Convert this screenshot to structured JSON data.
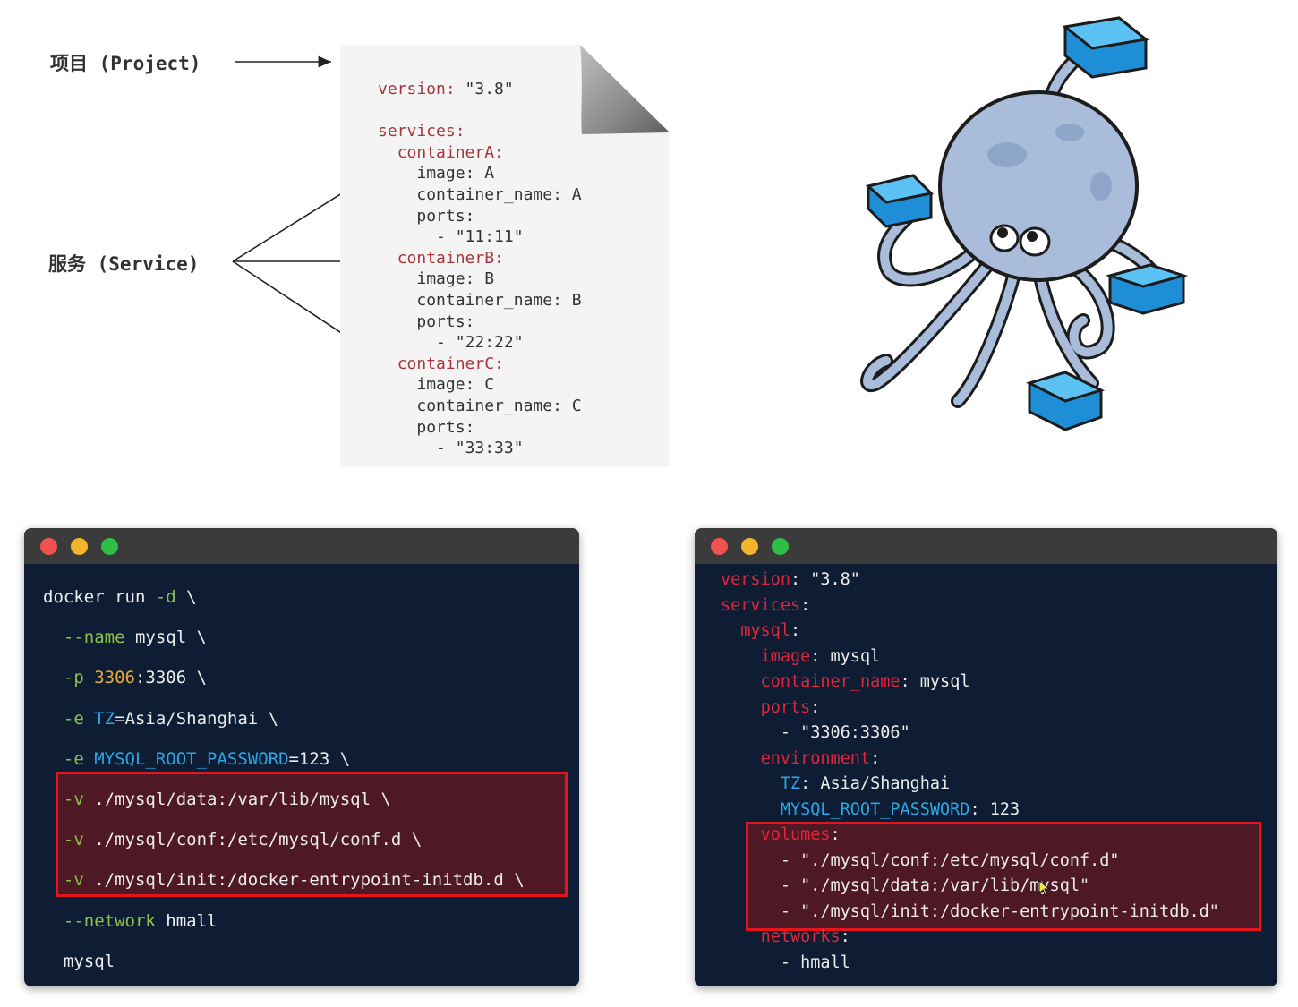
{
  "labels": {
    "project": "项目 (Project)",
    "service": "服务 (Service)"
  },
  "compose_doc": {
    "lines": [
      {
        "indent": "",
        "key": "version",
        "value": " \"3.8\""
      },
      {
        "indent": "",
        "key": "",
        "value": ""
      },
      {
        "indent": "",
        "key": "services",
        "value": ""
      },
      {
        "indent": "  ",
        "key": "containerA",
        "value": ""
      },
      {
        "indent": "    ",
        "key": "",
        "value": "image: A"
      },
      {
        "indent": "    ",
        "key": "",
        "value": "container_name: A"
      },
      {
        "indent": "    ",
        "key": "",
        "value": "ports:"
      },
      {
        "indent": "      ",
        "key": "",
        "value": "- \"11:11\""
      },
      {
        "indent": "  ",
        "key": "containerB",
        "value": ""
      },
      {
        "indent": "    ",
        "key": "",
        "value": "image: B"
      },
      {
        "indent": "    ",
        "key": "",
        "value": "container_name: B"
      },
      {
        "indent": "    ",
        "key": "",
        "value": "ports:"
      },
      {
        "indent": "      ",
        "key": "",
        "value": "- \"22:22\""
      },
      {
        "indent": "  ",
        "key": "containerC",
        "value": ""
      },
      {
        "indent": "    ",
        "key": "",
        "value": "image: C"
      },
      {
        "indent": "    ",
        "key": "",
        "value": "container_name: C"
      },
      {
        "indent": "    ",
        "key": "",
        "value": "ports:"
      },
      {
        "indent": "      ",
        "key": "",
        "value": "- \"33:33\""
      }
    ]
  },
  "docker_run": {
    "lines": [
      [
        {
          "t": "docker run ",
          "c": ""
        },
        {
          "t": "-d",
          "c": "green"
        },
        {
          "t": " \\",
          "c": ""
        }
      ],
      [
        {
          "t": "  --name",
          "c": "green"
        },
        {
          "t": " mysql \\",
          "c": ""
        }
      ],
      [
        {
          "t": "  -p ",
          "c": "green"
        },
        {
          "t": "3306",
          "c": "orange"
        },
        {
          "t": ":3306 \\",
          "c": ""
        }
      ],
      [
        {
          "t": "  -e ",
          "c": "green"
        },
        {
          "t": "TZ",
          "c": "blue"
        },
        {
          "t": "=Asia/Shanghai \\",
          "c": ""
        }
      ],
      [
        {
          "t": "  -e ",
          "c": "green"
        },
        {
          "t": "MYSQL_ROOT_PASSWORD",
          "c": "blue"
        },
        {
          "t": "=123 \\",
          "c": ""
        }
      ],
      [
        {
          "t": "  -v",
          "c": "green"
        },
        {
          "t": " ./mysql/data:/var/lib/mysql \\",
          "c": ""
        }
      ],
      [
        {
          "t": "  -v",
          "c": "green"
        },
        {
          "t": " ./mysql/conf:/etc/mysql/conf.d \\",
          "c": ""
        }
      ],
      [
        {
          "t": "  -v",
          "c": "green"
        },
        {
          "t": " ./mysql/init:/docker-entrypoint-initdb.d \\",
          "c": ""
        }
      ],
      [
        {
          "t": "  --network",
          "c": "green"
        },
        {
          "t": " hmall",
          "c": ""
        }
      ],
      [
        {
          "t": "  mysql",
          "c": ""
        }
      ]
    ]
  },
  "compose_yaml": {
    "lines": [
      [
        {
          "t": "version",
          "c": "red"
        },
        {
          "t": ": \"3.8\"",
          "c": ""
        }
      ],
      [
        {
          "t": "services",
          "c": "red"
        },
        {
          "t": ":",
          "c": ""
        }
      ],
      [
        {
          "t": "  ",
          "c": ""
        },
        {
          "t": "mysql",
          "c": "red"
        },
        {
          "t": ":",
          "c": ""
        }
      ],
      [
        {
          "t": "    ",
          "c": ""
        },
        {
          "t": "image",
          "c": "red"
        },
        {
          "t": ": mysql",
          "c": ""
        }
      ],
      [
        {
          "t": "    ",
          "c": ""
        },
        {
          "t": "container_name",
          "c": "red"
        },
        {
          "t": ": mysql",
          "c": ""
        }
      ],
      [
        {
          "t": "    ",
          "c": ""
        },
        {
          "t": "ports",
          "c": "red"
        },
        {
          "t": ":",
          "c": ""
        }
      ],
      [
        {
          "t": "      - \"3306:3306\"",
          "c": ""
        }
      ],
      [
        {
          "t": "    ",
          "c": ""
        },
        {
          "t": "environment",
          "c": "red"
        },
        {
          "t": ":",
          "c": ""
        }
      ],
      [
        {
          "t": "      ",
          "c": ""
        },
        {
          "t": "TZ",
          "c": "blue"
        },
        {
          "t": ": Asia/Shanghai",
          "c": ""
        }
      ],
      [
        {
          "t": "      ",
          "c": ""
        },
        {
          "t": "MYSQL_ROOT_PASSWORD",
          "c": "blue"
        },
        {
          "t": ": 123",
          "c": ""
        }
      ],
      [
        {
          "t": "    ",
          "c": ""
        },
        {
          "t": "volumes",
          "c": "red"
        },
        {
          "t": ":",
          "c": ""
        }
      ],
      [
        {
          "t": "      - \"./mysql/conf:/etc/mysql/conf.d\"",
          "c": ""
        }
      ],
      [
        {
          "t": "      - \"./mysql/data:/var/lib/mysql\"",
          "c": ""
        }
      ],
      [
        {
          "t": "      - \"./mysql/init:/docker-entrypoint-initdb.d\"",
          "c": ""
        }
      ],
      [
        {
          "t": "    ",
          "c": ""
        },
        {
          "t": "networks",
          "c": "red"
        },
        {
          "t": ":",
          "c": ""
        }
      ],
      [
        {
          "t": "      - hmall",
          "c": ""
        }
      ]
    ]
  },
  "colors": {
    "terminal_bg": "#0e1d33",
    "titlebar": "#3b3b3b",
    "highlight_border": "#e4161b",
    "yaml_key": "#a8363b"
  }
}
